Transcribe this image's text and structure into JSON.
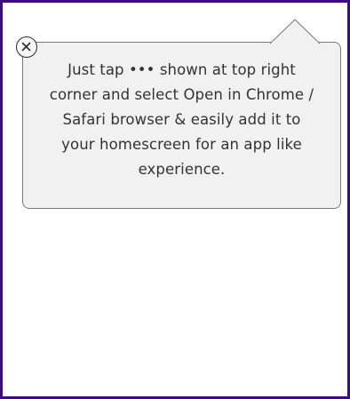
{
  "tooltip": {
    "message": "Just tap ••• shown at top right\ncorner and select Open in Chrome /\nSafari browser & easily add it to\nyour homescreen for an app like\nexperience."
  },
  "close_button": {
    "icon": "close-icon"
  },
  "colors": {
    "frame_border": "#3a0a8a",
    "tooltip_background": "#f1f1f1",
    "tooltip_border": "#7a7a7a",
    "text": "#333333"
  }
}
